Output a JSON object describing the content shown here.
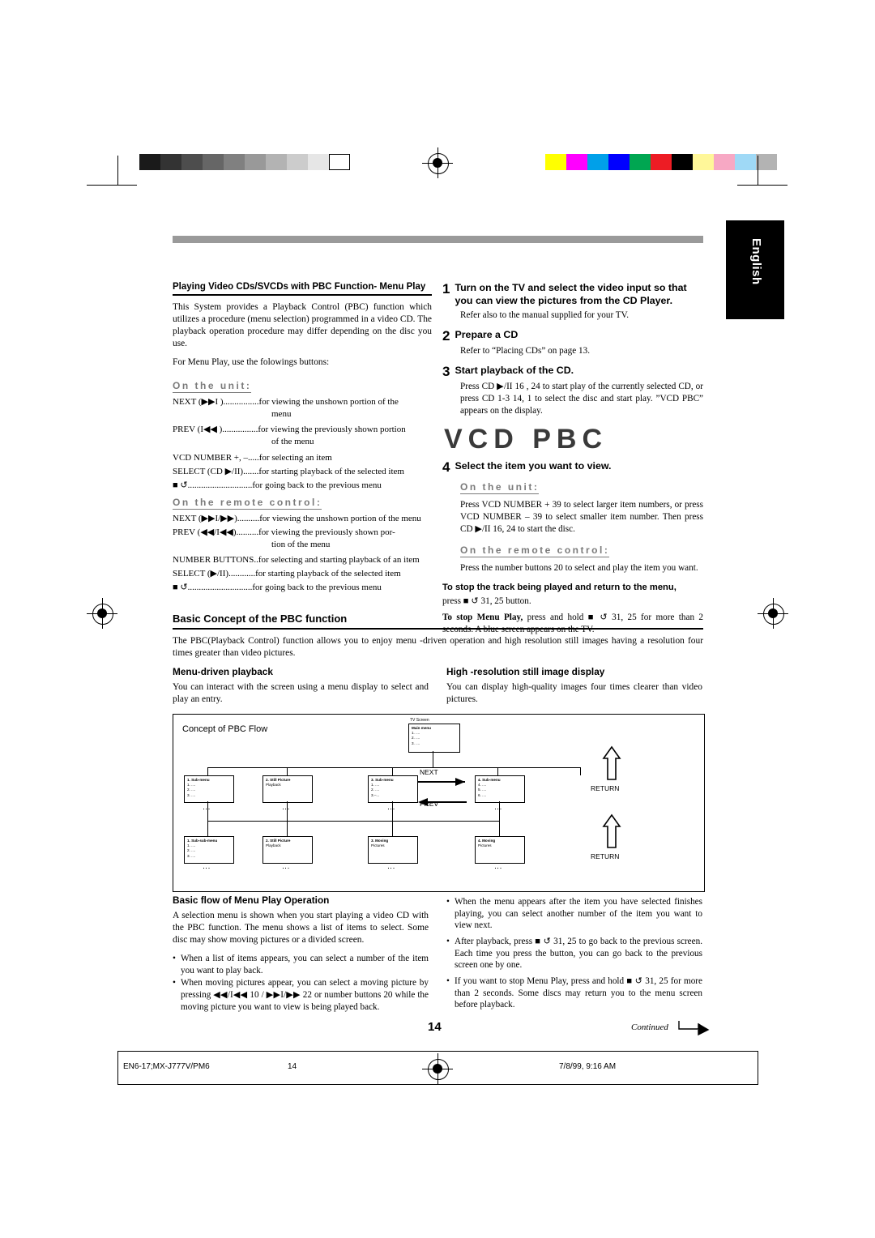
{
  "marks": {
    "english_tab": "English",
    "grey_swatches": [
      "#1a1a1a",
      "#333333",
      "#4d4d4d",
      "#666666",
      "#808080",
      "#999999",
      "#b3b3b3",
      "#cccccc",
      "#e6e6e6",
      "#ffffff"
    ],
    "color_swatches": [
      "#ffff00",
      "#ff00ff",
      "#00a0e9",
      "#0000ff",
      "#00a651",
      "#ed1c24",
      "#000000",
      "#fff799",
      "#f7a8c4",
      "#9fd9f6",
      "#b3b3b3"
    ]
  },
  "left": {
    "title": "Playing Video CDs/SVCDs with PBC Function- Menu Play",
    "intro": "This System provides a Playback Control (PBC) function which utilizes a procedure (menu selection) programmed in a video CD. The playback operation procedure may differ depending on the disc you use.",
    "menu_play_note": "For Menu Play, use the folowings buttons:",
    "unit_heading": "On the unit:",
    "unit_rows": [
      {
        "key": "NEXT (▶▶I )",
        "dots": " ................",
        "val": "for viewing the unshown portion of the",
        "cont": "menu"
      },
      {
        "key": "PREV (I◀◀ )",
        "dots": " ................",
        "val": "for viewing the previously shown portion",
        "cont": "of the menu"
      },
      {
        "key": "VCD NUMBER +, –",
        "dots": " .....",
        "val": "for selecting an item",
        "cont": ""
      },
      {
        "key": "SELECT (CD ▶/II)",
        "dots": " .......",
        "val": "for starting playback of the selected item",
        "cont": ""
      },
      {
        "key": "■ ↺",
        "dots": " .............................",
        "val": "for going back to the previous menu",
        "cont": ""
      }
    ],
    "remote_heading": "On the remote control:",
    "remote_rows": [
      {
        "key": "NEXT (▶▶I/▶▶)",
        "dots": " ..........",
        "val": "for viewing the unshown portion of the menu",
        "cont": ""
      },
      {
        "key": "PREV (◀◀/I◀◀)",
        "dots": " ..........",
        "val": "for viewing the previously shown por-",
        "cont": "tion  of the menu"
      },
      {
        "key": "NUMBER BUTTONS",
        "dots": " ..",
        "val": "for selecting and starting playback of an item",
        "cont": ""
      },
      {
        "key": "SELECT (▶/II)",
        "dots": " ............",
        "val": "for starting playback of the selected item",
        "cont": ""
      },
      {
        "key": "■ ↺",
        "dots": " .............................",
        "val": "for going back to the previous menu",
        "cont": ""
      }
    ]
  },
  "right": {
    "steps": [
      {
        "num": "1",
        "title": "Turn on the TV and select the video input so that you can view the pictures from the CD Player.",
        "body": "Refer also to the manual supplied for your TV."
      },
      {
        "num": "2",
        "title": "Prepare a CD",
        "body": "Refer to “Placing CDs” on page 13."
      },
      {
        "num": "3",
        "title": "Start playback of the CD.",
        "body": "Press CD ▶/II 16 , 24 to start play of the currently selected CD, or press CD 1-3 14, 1 to select the disc and start play. ”VCD PBC” appears on the display."
      },
      {
        "num": "4",
        "title": "Select the item you want to view.",
        "body": ""
      }
    ],
    "lcd_text": "VCD PBC",
    "unit_heading": "On the unit:",
    "unit_body": "Press VCD NUMBER + 39 to select larger item numbers, or press VCD NUMBER – 39 to select smaller item number. Then press CD ▶/II 16, 24 to start the disc.",
    "remote_heading": "On the remote control:",
    "remote_body": "Press the number buttons 20 to select and play the item you want.",
    "stop_track_heading": "To stop the track being played and return to the menu,",
    "stop_track_body": "press ■ ↺ 31, 25 button.",
    "stop_menu_body_bold": "To stop Menu Play,",
    "stop_menu_body": " press and hold ■ ↺ 31, 25 for more than 2 seconds. A blue screen appears on the TV."
  },
  "concept": {
    "title": "Basic Concept of the PBC function",
    "intro": "The PBC(Playback Control) function allows you to enjoy menu -driven operation and high resolution still images having a resolution four times greater than video pictures.",
    "left_heading": "Menu-driven playback",
    "left_body": "You can interact with the screen using a menu display to select and play an entry.",
    "right_heading": "High -resolution still image display",
    "right_body": "You can display high-quality images four times clearer than video pictures."
  },
  "diagram": {
    "caption": "Concept of PBC Flow",
    "tv_screen_label": "TV Screen",
    "main_menu": {
      "title": "Main menu",
      "lines": [
        "1. ....",
        "2. ....",
        "3. ...."
      ]
    },
    "row2": [
      {
        "title": "1. Sub-menu",
        "lines": [
          "1. ....",
          "2. ....",
          "3. ...."
        ]
      },
      {
        "title": "2. Still Picture",
        "lines": [
          "Playback"
        ]
      },
      {
        "title": "3. Sub-menu",
        "lines": [
          "1. ....",
          "2. ....",
          "3.–..."
        ]
      },
      {
        "title": "4. Sub-menu",
        "lines": [
          "4. ....",
          "5. ....",
          "6. ...."
        ]
      }
    ],
    "row3": [
      {
        "title": "1. Sub-sub-menu",
        "lines": [
          "1. ....",
          "2. ....",
          "3. ...."
        ]
      },
      {
        "title": "2. Still Picture",
        "lines": [
          "Playback"
        ]
      },
      {
        "title": "3. Moving",
        "lines": [
          "Pictures"
        ]
      },
      {
        "title": "4. Moving",
        "lines": [
          "Pictures"
        ]
      }
    ],
    "next_label": "NEXT",
    "prev_label": "PREV",
    "return_label_1": "RETURN",
    "return_label_2": "RETURN"
  },
  "basic_flow": {
    "title": "Basic flow of Menu Play Operation",
    "intro": "A selection menu is shown when you start playing a video CD with the PBC function. The menu shows a list of items to select. Some disc may show moving pictures or a divided screen.",
    "left_bullets": [
      "When a list of items appears, you can select a number of the item you want to play back.",
      "When moving pictures appear, you can select a moving picture by pressing ◀◀/I◀◀ 10 / ▶▶I/▶▶ 22 or number buttons 20 while the moving picture you want to view is being played back."
    ],
    "right_bullets": [
      "When the menu appears after the item you have selected finishes playing, you can select another number of the item you want to view next.",
      "After playback, press ■ ↺ 31, 25 to go back to the previous screen. Each time you press the button, you can go back to the previous screen one by one.",
      "If you want to stop Menu Play, press and hold ■ ↺ 31, 25 for more than 2 seconds. Some discs may return you to the menu screen before playback."
    ]
  },
  "page_number": "14",
  "continued": "Continued",
  "footer": {
    "left": "EN6-17;MX-J777V/PM6",
    "page": "14",
    "date": "7/8/99, 9:16 AM"
  }
}
